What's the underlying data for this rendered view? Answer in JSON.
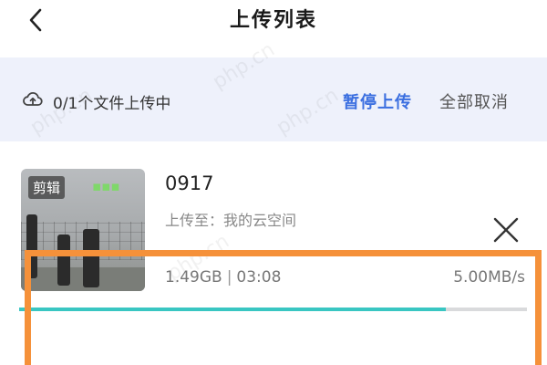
{
  "header": {
    "title": "上传列表",
    "back_icon": "chevron-left-icon"
  },
  "status": {
    "summary": "0/1个文件上传中",
    "pause_label": "暂停上传",
    "cancel_all_label": "全部取消",
    "cloud_icon": "cloud-upload-icon",
    "accent_color": "#3b6fe0"
  },
  "upload_item": {
    "thumbnail_tag": "剪辑",
    "file_name": "0917",
    "destination": "上传至：我的云空间",
    "size": "1.49GB",
    "duration": "03:08",
    "separator": "|",
    "speed": "5.00MB/s",
    "progress": 0.84,
    "progress_color": "#39c6c2",
    "close_icon": "close-icon"
  },
  "highlight": {
    "color": "#f5913a"
  }
}
